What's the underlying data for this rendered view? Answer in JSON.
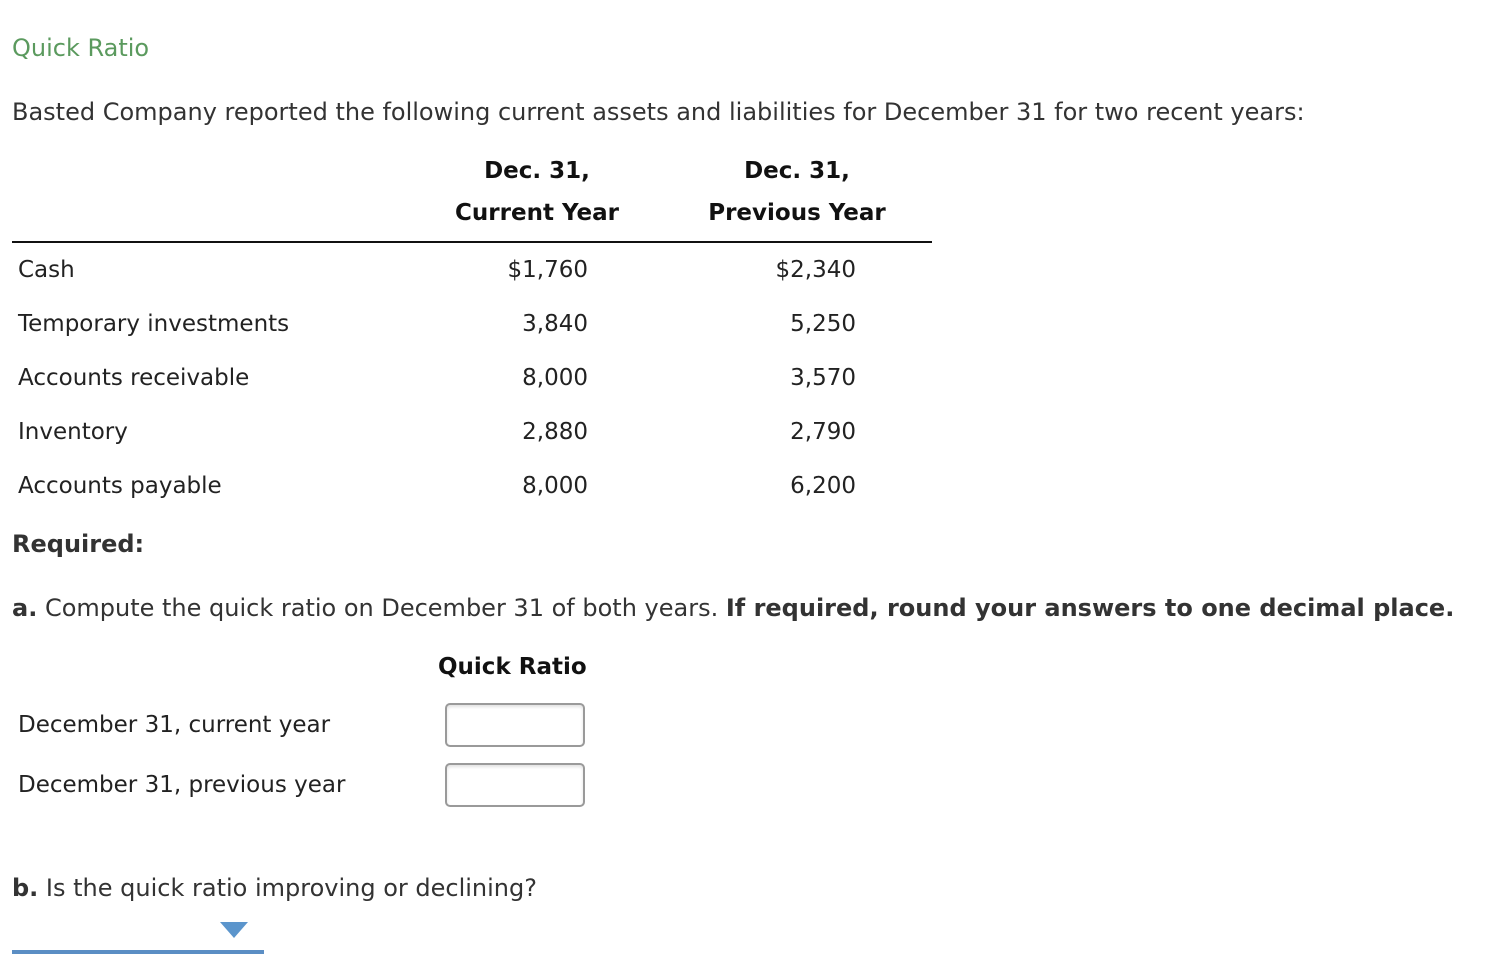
{
  "title": "Quick Ratio",
  "intro": "Basted Company reported the following current assets and liabilities for December 31 for two recent years:",
  "table": {
    "columns": [
      {
        "line1": "Dec. 31,",
        "line2": "Current Year"
      },
      {
        "line1": "Dec. 31,",
        "line2": "Previous Year"
      }
    ],
    "rows": [
      {
        "label": "Cash",
        "current": "$1,760",
        "previous": "$2,340"
      },
      {
        "label": "Temporary investments",
        "current": "3,840",
        "previous": "5,250"
      },
      {
        "label": "Accounts receivable",
        "current": "8,000",
        "previous": "3,570"
      },
      {
        "label": "Inventory",
        "current": "2,880",
        "previous": "2,790"
      },
      {
        "label": "Accounts payable",
        "current": "8,000",
        "previous": "6,200"
      }
    ]
  },
  "required_label": "Required:",
  "part_a": {
    "prefix": "a.",
    "text": " Compute the quick ratio on December 31 of both years. ",
    "emphasis": "If required, round your answers to one decimal place.",
    "column_header": "Quick Ratio",
    "inputs": [
      {
        "label": "December 31, current year",
        "value": ""
      },
      {
        "label": "December 31, previous year",
        "value": ""
      }
    ]
  },
  "part_b": {
    "prefix": "b.",
    "text": " Is the quick ratio improving or declining?",
    "dropdown_value": ""
  }
}
